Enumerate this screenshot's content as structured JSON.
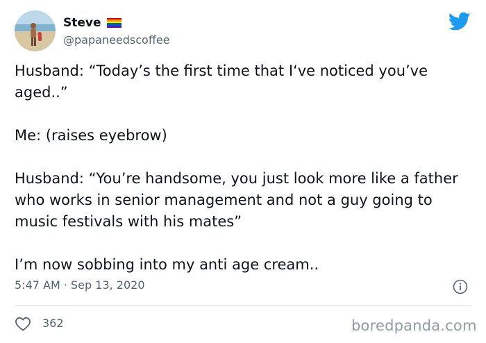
{
  "author": {
    "display_name": "Steve",
    "handle": "@papaneedscoffee",
    "avatar_icon": "beach-photo-avatar",
    "badge_icon": "rainbow-flag-icon",
    "flag_colors": [
      "#e40303",
      "#ff8c00",
      "#ffed00",
      "#008026",
      "#004dff",
      "#750787"
    ]
  },
  "brand": {
    "icon": "twitter-bird-icon",
    "color": "#1d9bf0"
  },
  "tweet": {
    "paragraphs": [
      "Husband: “Today’s the first time that I‘ve noticed you’ve aged..”",
      "Me: (raises eyebrow)",
      "Husband: “You’re handsome, you just look more like a father who works in senior management and not a guy going to music festivals with his mates”",
      "I’m now sobbing into my anti age cream.."
    ],
    "timestamp": "5:47 AM · Sep 13, 2020"
  },
  "actions": {
    "info_icon": "info-icon",
    "like_icon": "heart-icon",
    "like_count": "362"
  },
  "watermark": "boredpanda.com"
}
